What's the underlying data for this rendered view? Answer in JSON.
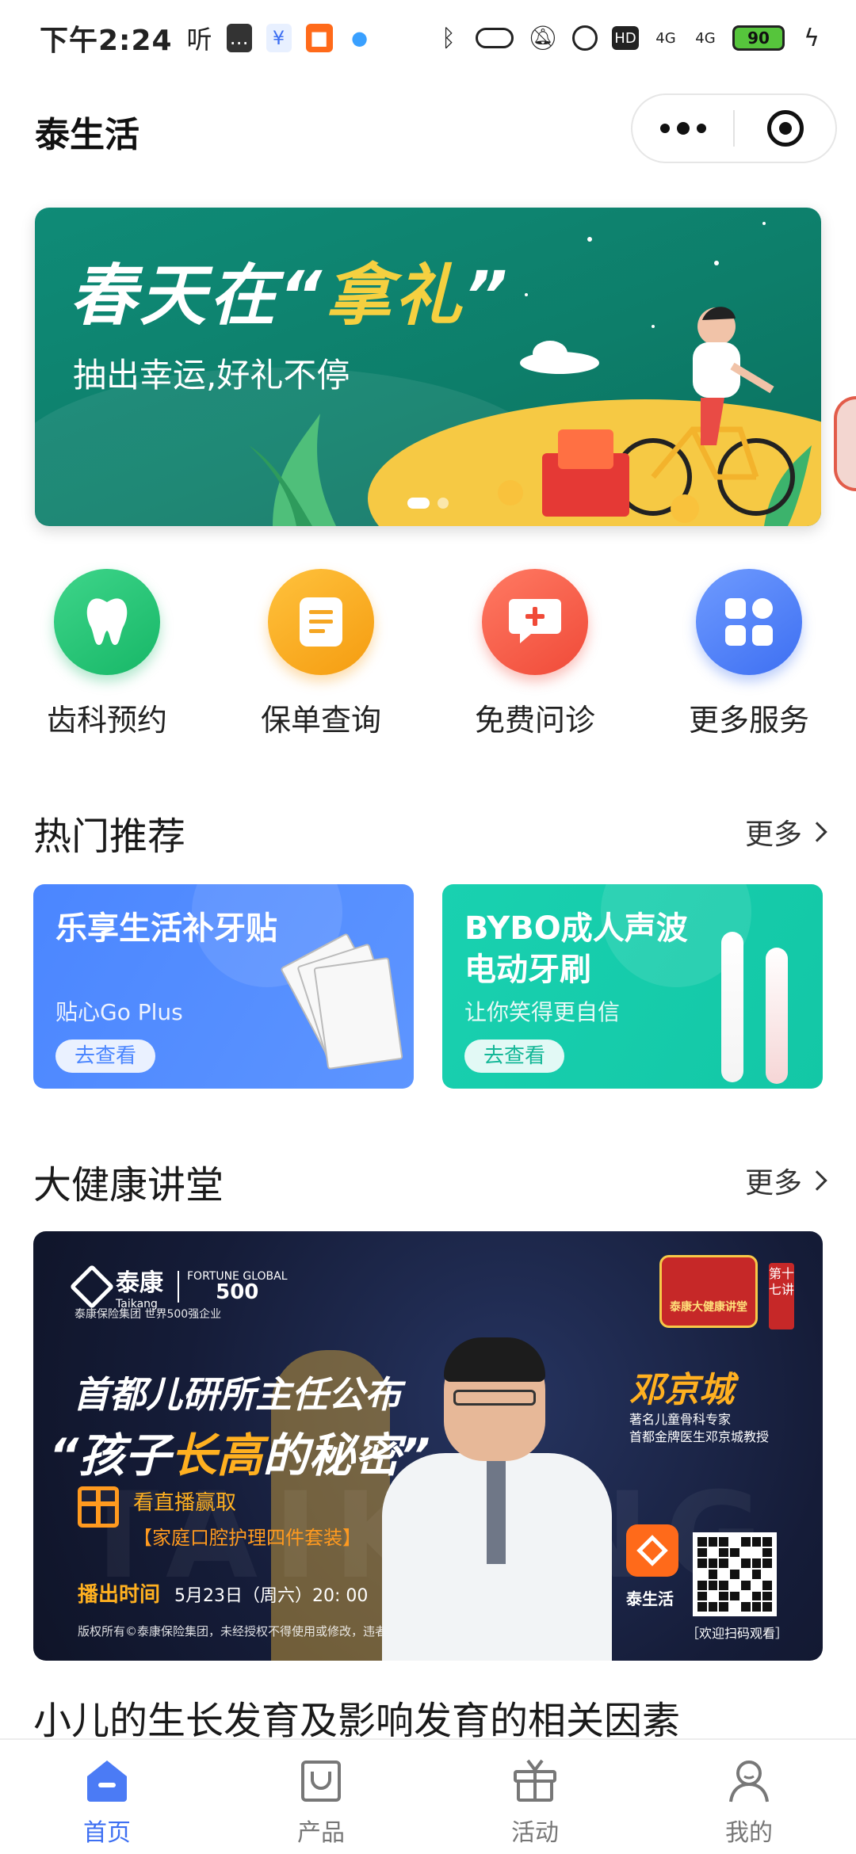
{
  "status_bar": {
    "time": "下午2:24",
    "ting": "听",
    "signal1": "4G",
    "signal2": "4G",
    "battery": "90"
  },
  "header": {
    "title": "泰生活"
  },
  "banner": {
    "title_prefix": "春天在“",
    "title_highlight": "拿礼",
    "title_suffix": "”",
    "subtitle": "抽出幸运,好礼不停"
  },
  "services": [
    {
      "label": "齿科预约",
      "icon": "tooth-icon",
      "color": "#1dbb6e"
    },
    {
      "label": "保单查询",
      "icon": "document-icon",
      "color": "#f59c10"
    },
    {
      "label": "免费问诊",
      "icon": "chat-plus-icon",
      "color": "#f04a38"
    },
    {
      "label": "更多服务",
      "icon": "grid-icon",
      "color": "#3d6ff2"
    }
  ],
  "hot": {
    "title": "热门推荐",
    "more": "更多",
    "cards": [
      {
        "title": "乐享生活补牙贴",
        "subtitle": "贴心Go Plus",
        "button": "去查看"
      },
      {
        "title": "BYBO成人声波电动牙刷",
        "subtitle": "让你笑得更自信",
        "button": "去查看"
      }
    ]
  },
  "lecture": {
    "title": "大健康讲堂",
    "more": "更多",
    "poster": {
      "brand": "泰康",
      "brand_en": "Taikang",
      "fortune_top": "FORTUNE GLOBAL",
      "fortune_num": "500",
      "brand_sub": "泰康保险集团 世界500强企业",
      "headline1": "首都儿研所主任公布",
      "headline2_a": "“孩子",
      "headline2_hl": "长高",
      "headline2_b": "的秘密”",
      "gift_line1": "看直播赢取",
      "gift_line2": "【家庭口腔护理四件套装】",
      "air_label": "播出时间",
      "air_time": "5月23日（周六）20: 00",
      "copyright": "版权所有©泰康保险集团，未经授权不得使用或修改，违者必究！",
      "badge": "泰康大健康讲堂",
      "episode": "第十七讲",
      "doctor_name": "邓京城",
      "doctor_title1": "著名儿童骨科专家",
      "doctor_title2": "首都金牌医生邓京城教授",
      "app_label": "泰生活",
      "qr_label": "［欢迎扫码观看］",
      "watermark": "TAIKANG"
    }
  },
  "article_title": "小儿的生长发育及影响发育的相关因素",
  "tabbar": [
    {
      "label": "首页",
      "icon": "home-icon",
      "active": true
    },
    {
      "label": "产品",
      "icon": "bag-icon",
      "active": false
    },
    {
      "label": "活动",
      "icon": "gift-icon",
      "active": false
    },
    {
      "label": "我的",
      "icon": "user-icon",
      "active": false
    }
  ],
  "colors": {
    "accent": "#3d6ff2",
    "banner_bg": "#0f8b77",
    "card_blue": "#4b86ff",
    "card_teal": "#19d1b0",
    "poster_bg": "#151c38",
    "highlight": "#ffb020"
  }
}
